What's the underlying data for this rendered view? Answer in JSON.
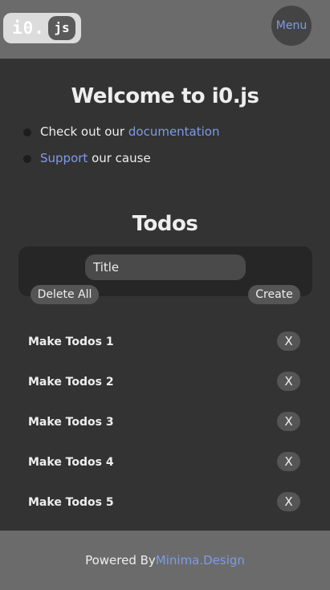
{
  "header": {
    "logo_text": "i0.",
    "logo_badge": "js",
    "menu_label": "Menu"
  },
  "welcome": {
    "title": "Welcome to i0.js",
    "line1_prefix": "Check out our ",
    "line1_link": "documentation",
    "line2_link": "Support",
    "line2_suffix": " our cause"
  },
  "todos": {
    "title": "Todos",
    "input_placeholder": "Title",
    "delete_all_label": "Delete All",
    "create_label": "Create",
    "remove_label": "X",
    "items": [
      {
        "label": "Make Todos 1"
      },
      {
        "label": "Make Todos 2"
      },
      {
        "label": "Make Todos 3"
      },
      {
        "label": "Make Todos 4"
      },
      {
        "label": "Make Todos 5"
      }
    ]
  },
  "footer": {
    "prefix": "Powered By",
    "link": "Minima.Design"
  },
  "colors": {
    "background": "#333333",
    "bar": "#6b6b6b",
    "link": "#7e9be6",
    "button": "#555555"
  }
}
